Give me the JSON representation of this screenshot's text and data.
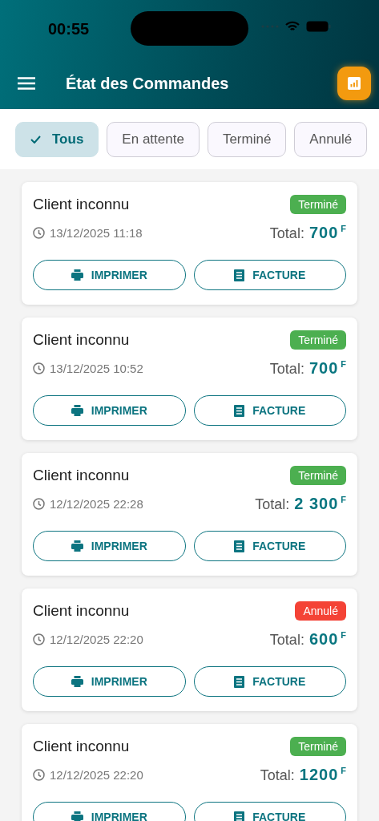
{
  "status_bar": {
    "time": "00:55"
  },
  "app_bar": {
    "title": "État des Commandes"
  },
  "filters": [
    {
      "label": "Tous",
      "selected": true
    },
    {
      "label": "En attente",
      "selected": false
    },
    {
      "label": "Terminé",
      "selected": false
    },
    {
      "label": "Annulé",
      "selected": false
    }
  ],
  "orders": [
    {
      "client": "Client inconnu",
      "status": "Terminé",
      "kind": "done",
      "date": "13/12/2025 11:18",
      "total_label": "Total:",
      "amount": "700",
      "currency": "F",
      "buttons": [
        "IMPRIMER",
        "FACTURE"
      ]
    },
    {
      "client": "Client inconnu",
      "status": "Terminé",
      "kind": "done",
      "date": "13/12/2025 10:52",
      "total_label": "Total:",
      "amount": "700",
      "currency": "F",
      "buttons": [
        "IMPRIMER",
        "FACTURE"
      ]
    },
    {
      "client": "Client inconnu",
      "status": "Terminé",
      "kind": "done",
      "date": "12/12/2025 22:28",
      "total_label": "Total:",
      "amount": "2 300",
      "currency": "F",
      "buttons": [
        "IMPRIMER",
        "FACTURE"
      ]
    },
    {
      "client": "Client inconnu",
      "status": "Annulé",
      "kind": "cancelled",
      "date": "12/12/2025 22:20",
      "total_label": "Total:",
      "amount": "600",
      "currency": "F",
      "buttons": [
        "IMPRIMER",
        "FACTURE"
      ]
    },
    {
      "client": "Client inconnu",
      "status": "Terminé",
      "kind": "done",
      "date": "12/12/2025 22:20",
      "total_label": "Total:",
      "amount": "1200",
      "currency": "F",
      "buttons": [
        "IMPRIMER",
        "FACTURE"
      ]
    }
  ]
}
